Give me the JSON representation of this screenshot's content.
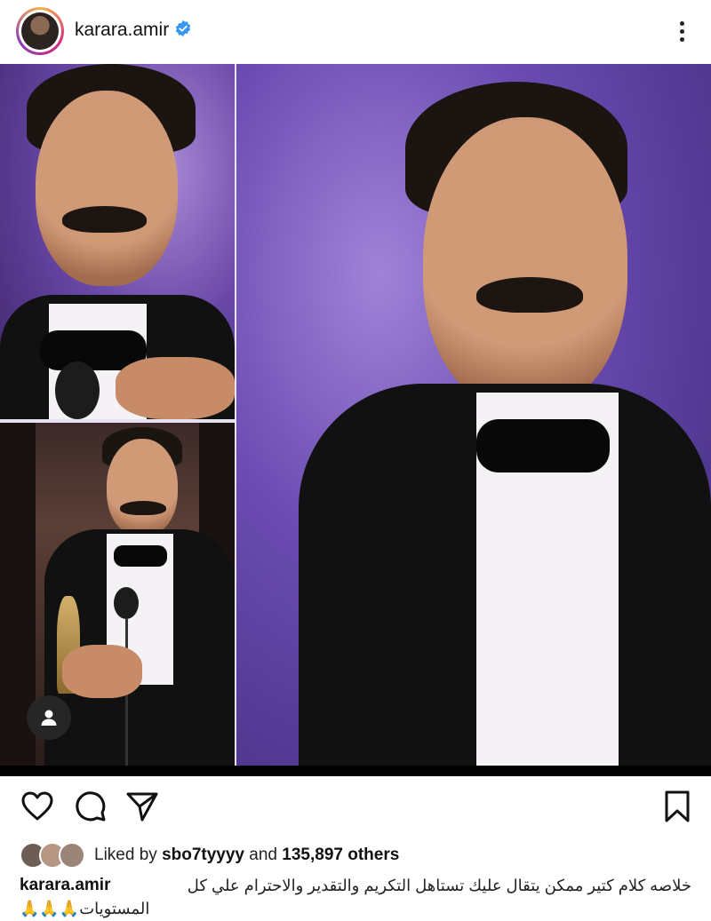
{
  "post": {
    "username": "karara.amir",
    "verified": true,
    "more_icon": "more-vertical-icon"
  },
  "actions": {
    "like_icon": "heart-icon",
    "comment_icon": "comment-icon",
    "share_icon": "send-icon",
    "save_icon": "bookmark-icon"
  },
  "likes": {
    "prefix": "Liked by",
    "liker": "sbo7tyyyy",
    "connector": "and",
    "others": "135,897 others"
  },
  "caption": {
    "username": "karara.amir",
    "line1": "خلاصه كلام كتير ممكن يتقال عليك تستاهل التكريم والتقدير والاحترام علي كل",
    "line2": "المستويات🙏🙏🙏"
  },
  "colors": {
    "accent_verified": "#3897f0",
    "background": "#ffffff"
  }
}
